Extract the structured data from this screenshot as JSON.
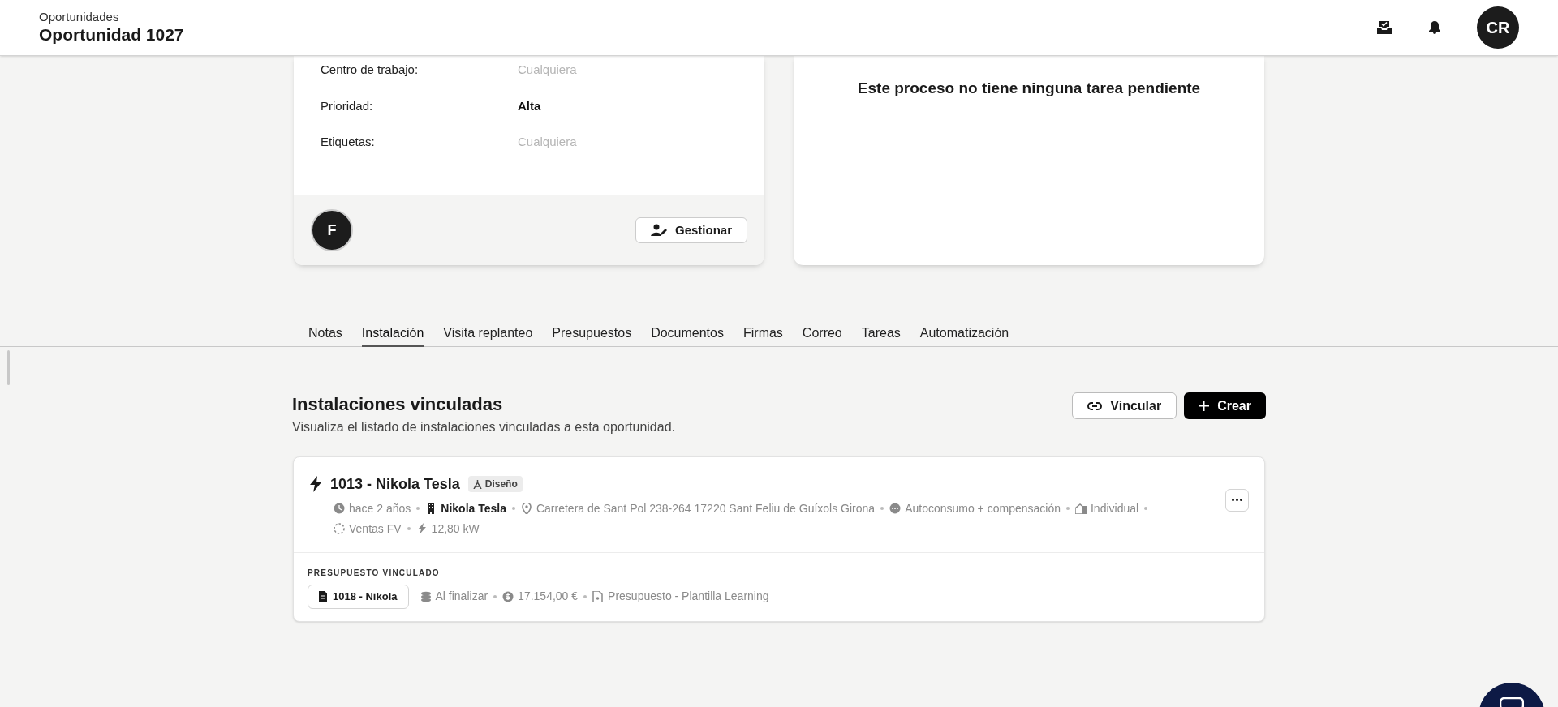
{
  "header": {
    "breadcrumb": "Oportunidades",
    "title": "Oportunidad 1027",
    "avatar": "CR"
  },
  "details": {
    "fields": [
      {
        "label": "Centro de trabajo:",
        "placeholder": "Cualquiera"
      },
      {
        "label": "Prioridad:",
        "value": "Alta"
      },
      {
        "label": "Etiquetas:",
        "placeholder": "Cualquiera"
      }
    ],
    "owner_avatar": "F",
    "manage_button": "Gestionar"
  },
  "tasks_panel": {
    "message": "Este proceso no tiene ninguna tarea pendiente"
  },
  "tabs": [
    {
      "label": "Notas",
      "selected": false
    },
    {
      "label": "Instalación",
      "selected": true
    },
    {
      "label": "Visita replanteo",
      "selected": false
    },
    {
      "label": "Presupuestos",
      "selected": false
    },
    {
      "label": "Documentos",
      "selected": false
    },
    {
      "label": "Firmas",
      "selected": false
    },
    {
      "label": "Correo",
      "selected": false
    },
    {
      "label": "Tareas",
      "selected": false
    },
    {
      "label": "Automatización",
      "selected": false
    }
  ],
  "section": {
    "title": "Instalaciones vinculadas",
    "subtitle": "Visualiza el listado de instalaciones vinculadas a esta oportunidad.",
    "buttons": [
      {
        "label": "Vincular",
        "kind": "link"
      },
      {
        "label": "Crear",
        "kind": "create"
      }
    ]
  },
  "installation": {
    "title": "1013 - Nikola Tesla",
    "tag": "Diseño",
    "meta": [
      {
        "kind": "time",
        "text": "hace 2 años"
      },
      {
        "kind": "client",
        "text": "Nikola Tesla"
      },
      {
        "kind": "location",
        "text": "Carretera de Sant Pol 238-264 17220 Sant Feliu de Guíxols Girona"
      },
      {
        "kind": "mode",
        "text": "Autoconsumo + compensación"
      },
      {
        "kind": "house",
        "text": "Individual"
      },
      {
        "kind": "pipeline",
        "text": "Ventas FV"
      },
      {
        "kind": "power",
        "text": "12,80 kW"
      }
    ],
    "budget": {
      "label": "PRESUPUESTO VINCULADO",
      "chip": "1018 - Nikola",
      "meta": [
        {
          "kind": "coins",
          "text": "Al finalizar"
        },
        {
          "kind": "money",
          "text": "17.154,00 €"
        },
        {
          "kind": "document",
          "text": "Presupuesto - Plantilla Learning"
        }
      ]
    }
  }
}
